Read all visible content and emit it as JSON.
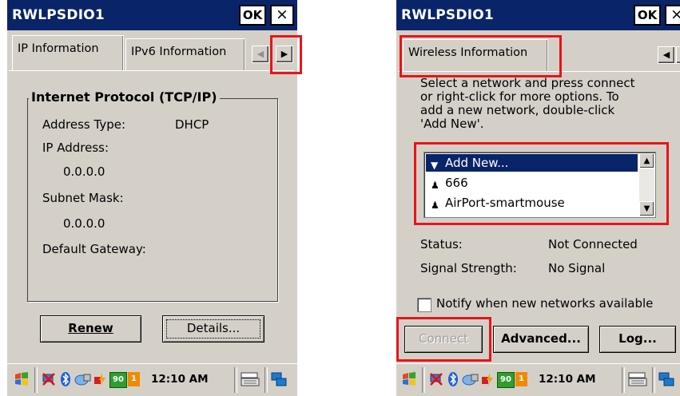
{
  "left": {
    "window_title": "RWLPSDIO1",
    "ok_label": "OK",
    "close_label": "×",
    "tabs": [
      "IP Information",
      "IPv6 Information"
    ],
    "tab_scroll_left": "◀",
    "tab_scroll_right": "▶",
    "group_title": "Internet Protocol (TCP/IP)",
    "address_type_label": "Address Type:",
    "address_type_value": "DHCP",
    "ip_address_label": "IP Address:",
    "ip_address_value": "0.0.0.0",
    "subnet_mask_label": "Subnet Mask:",
    "subnet_mask_value": "0.0.0.0",
    "default_gateway_label": "Default Gateway:",
    "renew_label": "Renew",
    "details_label": "Details...",
    "clock": "12:10 AM",
    "battery_percent": "90",
    "notification_badge": "1"
  },
  "right": {
    "window_title": "RWLPSDIO1",
    "ok_label": "OK",
    "close_label": "×",
    "tab_label": "Wireless Information",
    "tab_scroll_left": "◀",
    "tab_scroll_right": "▶",
    "instructions": [
      "Select a network and press connect",
      "or right-click for more options.  To",
      "add a new network, double-click",
      "'Add New'."
    ],
    "networks": [
      {
        "name": "Add New...",
        "selected": true
      },
      {
        "name": "666",
        "selected": false
      },
      {
        "name": "AirPort-smartmouse",
        "selected": false
      }
    ],
    "status_label": "Status:",
    "status_value": "Not Connected",
    "signal_label": "Signal Strength:",
    "signal_value": "No Signal",
    "notify_label": "Notify when new networks available",
    "notify_checked": false,
    "connect_label": "Connect",
    "advanced_label": "Advanced...",
    "log_label": "Log...",
    "clock": "12:10 AM",
    "battery_percent": "90",
    "notification_badge": "1"
  },
  "colors": {
    "titlebar": "#0a246a",
    "highlight_outline": "#e8141a",
    "dialog_face": "#d4d0c8"
  },
  "icons": {
    "start": "windows-flag-icon",
    "network": "network-disconnected-icon",
    "bluetooth": "bluetooth-icon",
    "connection": "connection-icon",
    "power": "power-plug-icon",
    "battery": "battery-icon",
    "keyboard": "keyboard-icon",
    "desktop": "desktop-switch-icon",
    "network_entry": "wireless-network-icon"
  }
}
